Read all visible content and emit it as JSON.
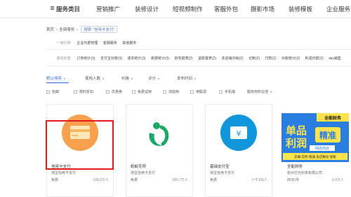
{
  "topnav": {
    "items": [
      "服务类目",
      "营销推广",
      "装修设计",
      "短视频制作",
      "客服外包",
      "摄影市场",
      "装修模板",
      "企业服务"
    ]
  },
  "breadcrumb": {
    "home": "首页",
    "all": "全部服务",
    "search_tag": "搜索 \"信用卡支付\""
  },
  "filters": {
    "category_label": "一级分类:",
    "category_options": [
      "企业内部管理",
      "金融服务",
      "其他服务"
    ],
    "tag_label": "服务标签:",
    "tag_options": [
      "订单统计(3)",
      "支付宝对账(3)",
      "成本统计(3)",
      "和费统计(3)",
      "财务报表(2)",
      "退款报表(2)",
      "多店铺归纳(2)",
      "记账(2)",
      "付款(2)",
      "对账统计(2)",
      "利润日报(2)",
      "sku销售"
    ]
  },
  "sortbar": {
    "items": [
      "默认排序",
      "使用人数",
      "价格",
      "评分",
      "发布时间"
    ]
  },
  "checks": {
    "items": [
      "包邮",
      "限时折扣",
      "优惠券",
      "免费试用",
      "淘拍档",
      "电联调",
      "手机端",
      "服务商所在地"
    ]
  },
  "cards": [
    {
      "title": "信用卡支付",
      "vendor": "淘宝信用卡支付",
      "price": "免费",
      "users": "328.6万人",
      "icon_color": "#f7a04d",
      "icon": "credit-card-icon"
    },
    {
      "title": "蚂蚁花呗",
      "vendor": "淘宝信用卡支付",
      "price": "免费",
      "users": "280.7万人",
      "icon_color": "#ffffff",
      "icon": "huabei-icon"
    },
    {
      "title": "基础支付宝",
      "vendor": "淘宝信用卡支付",
      "price": "免费",
      "users": "少于100人",
      "icon_color": "#1296db",
      "icon": "yuan-icon"
    }
  ],
  "ad": {
    "line1": "单品",
    "line2": "利润",
    "badge": "精准",
    "brand": "全能财务",
    "sub": "网店商店",
    "note": "云端·实时·快速·多店数号·轻松",
    "title": "全能财务",
    "vendor": "杭州亿光科技有限公司",
    "price": "85元/月",
    "users": "3.4万人"
  }
}
